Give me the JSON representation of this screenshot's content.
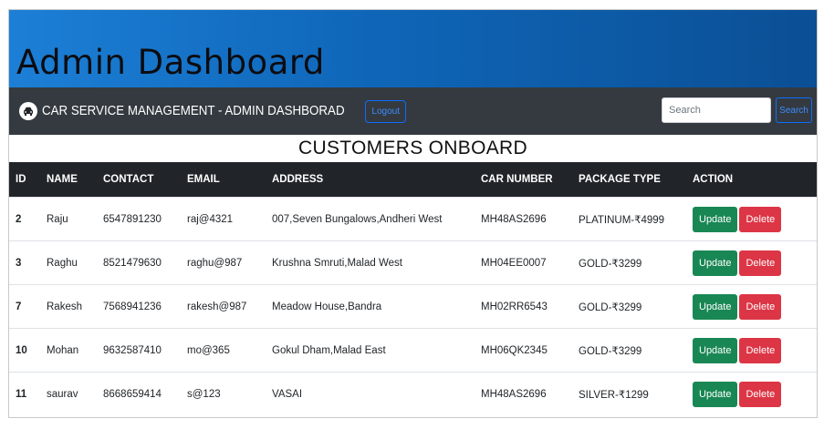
{
  "page": {
    "title": "Admin Dashboard"
  },
  "navbar": {
    "logo_icon": "car-icon",
    "brand": "CAR SERVICE MANAGEMENT - ADMIN DASHBORAD",
    "logout_label": "Logout",
    "search_placeholder": "Search",
    "search_value": "",
    "search_button_label": "Search"
  },
  "section": {
    "title": "CUSTOMERS ONBOARD"
  },
  "table": {
    "headers": [
      "ID",
      "NAME",
      "CONTACT",
      "EMAIL",
      "ADDRESS",
      "CAR NUMBER",
      "PACKAGE TYPE",
      "ACTION"
    ],
    "rows": [
      {
        "id": "2",
        "name": "Raju",
        "contact": "6547891230",
        "email": "raj@4321",
        "address": "007,Seven Bungalows,Andheri West",
        "car_number": "MH48AS2696",
        "package": "PLATINUM-₹4999",
        "update_label": "Update",
        "delete_label": "Delete"
      },
      {
        "id": "3",
        "name": "Raghu",
        "contact": "8521479630",
        "email": "raghu@987",
        "address": "Krushna Smruti,Malad West",
        "car_number": "MH04EE0007",
        "package": "GOLD-₹3299",
        "update_label": "Update",
        "delete_label": "Delete"
      },
      {
        "id": "7",
        "name": "Rakesh",
        "contact": "7568941236",
        "email": "rakesh@987",
        "address": "Meadow House,Bandra",
        "car_number": "MH02RR6543",
        "package": "GOLD-₹3299",
        "update_label": "Update",
        "delete_label": "Delete"
      },
      {
        "id": "10",
        "name": "Mohan",
        "contact": "9632587410",
        "email": "mo@365",
        "address": "Gokul Dham,Malad East",
        "car_number": "MH06QK2345",
        "package": "GOLD-₹3299",
        "update_label": "Update",
        "delete_label": "Delete"
      },
      {
        "id": "11",
        "name": "saurav",
        "contact": "8668659414",
        "email": "s@123",
        "address": "VASAI",
        "car_number": "MH48AS2696",
        "package": "SILVER-₹1299",
        "update_label": "Update",
        "delete_label": "Delete"
      }
    ]
  },
  "colors": {
    "banner": "#0f66b8",
    "navbar": "#343a40",
    "table_header": "#212529",
    "update": "#198754",
    "delete": "#dc3545",
    "outline_button": "#0d6efd"
  }
}
